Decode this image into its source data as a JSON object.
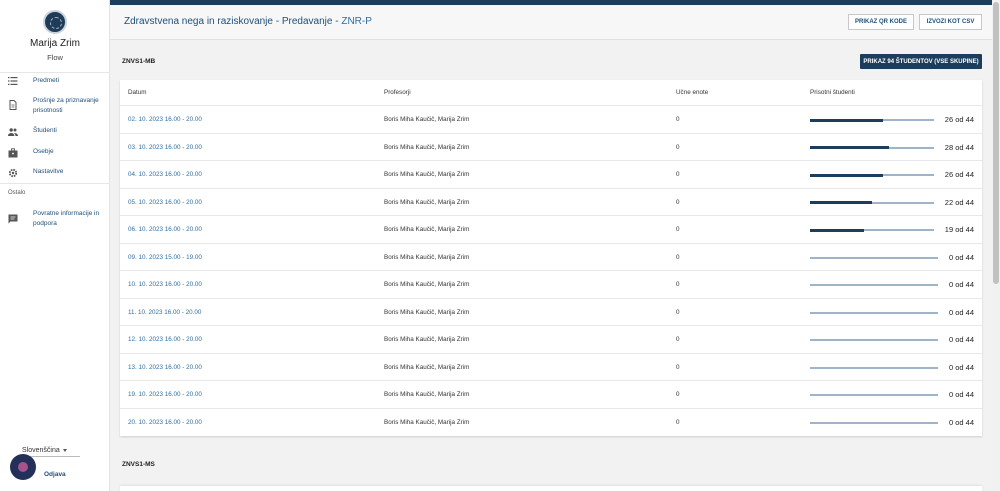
{
  "sidebar": {
    "user_name": "Marija Zrim",
    "user_role": "Flow",
    "items": [
      {
        "label": "Predmeti",
        "icon": "list-icon"
      },
      {
        "label": "Prošnje za priznavanje prisotnosti",
        "icon": "document-icon"
      },
      {
        "label": "Študenti",
        "icon": "people-icon"
      },
      {
        "label": "Osebje",
        "icon": "briefcase-icon"
      },
      {
        "label": "Nastavitve",
        "icon": "gear-icon"
      }
    ],
    "section_other": "Ostalo",
    "feedback_label": "Povratne informacije in podpora",
    "language": "Slovenščina",
    "logout": "Odjava"
  },
  "header": {
    "title_main": "Zdravstvena nega in raziskovanje - Predavanje - ",
    "title_code": "ZNR-P",
    "qr_button": "PRIKAZ QR KODE",
    "csv_button": "IZVOZI KOT CSV"
  },
  "group1": {
    "name": "ZNVS1-MB",
    "show_students_button": "PRIKAZ 94 ŠTUDENTOV (VSE SKUPINE)"
  },
  "group2": {
    "name": "ZNVS1-MS"
  },
  "table": {
    "headers": [
      "Datum",
      "Profesorji",
      "Učne enote",
      "Prisotni študenti"
    ],
    "rows": [
      {
        "date": "02. 10. 2023 16.00 - 20.00",
        "profs": "Boris Miha Kaučič, Marija Zrim",
        "units": "0",
        "present": 26,
        "total": 44,
        "count": "26 od 44"
      },
      {
        "date": "03. 10. 2023 16.00 - 20.00",
        "profs": "Boris Miha Kaučič, Marija Zrim",
        "units": "0",
        "present": 28,
        "total": 44,
        "count": "28 od 44"
      },
      {
        "date": "04. 10. 2023 16.00 - 20.00",
        "profs": "Boris Miha Kaučič, Marija Zrim",
        "units": "0",
        "present": 26,
        "total": 44,
        "count": "26 od 44"
      },
      {
        "date": "05. 10. 2023 16.00 - 20.00",
        "profs": "Boris Miha Kaučič, Marija Zrim",
        "units": "0",
        "present": 22,
        "total": 44,
        "count": "22 od 44"
      },
      {
        "date": "06. 10. 2023 16.00 - 20.00",
        "profs": "Boris Miha Kaučič, Marija Zrim",
        "units": "0",
        "present": 19,
        "total": 44,
        "count": "19 od 44"
      },
      {
        "date": "09. 10. 2023 15.00 - 19.00",
        "profs": "Boris Miha Kaučič, Marija Zrim",
        "units": "0",
        "present": 0,
        "total": 44,
        "count": "0 od 44"
      },
      {
        "date": "10. 10. 2023 16.00 - 20.00",
        "profs": "Boris Miha Kaučič, Marija Zrim",
        "units": "0",
        "present": 0,
        "total": 44,
        "count": "0 od 44"
      },
      {
        "date": "11. 10. 2023 16.00 - 20.00",
        "profs": "Boris Miha Kaučič, Marija Zrim",
        "units": "0",
        "present": 0,
        "total": 44,
        "count": "0 od 44"
      },
      {
        "date": "12. 10. 2023 16.00 - 20.00",
        "profs": "Boris Miha Kaučič, Marija Zrim",
        "units": "0",
        "present": 0,
        "total": 44,
        "count": "0 od 44"
      },
      {
        "date": "13. 10. 2023 16.00 - 20.00",
        "profs": "Boris Miha Kaučič, Marija Zrim",
        "units": "0",
        "present": 0,
        "total": 44,
        "count": "0 od 44"
      },
      {
        "date": "19. 10. 2023 16.00 - 20.00",
        "profs": "Boris Miha Kaučič, Marija Zrim",
        "units": "0",
        "present": 0,
        "total": 44,
        "count": "0 od 44"
      },
      {
        "date": "20. 10. 2023 16.00 - 20.00",
        "profs": "Boris Miha Kaučič, Marija Zrim",
        "units": "0",
        "present": 0,
        "total": 44,
        "count": "0 od 44"
      }
    ]
  },
  "colors": {
    "primary": "#1c3d5c",
    "link": "#2f6ea3",
    "bar_track": "#9fb4c8"
  }
}
